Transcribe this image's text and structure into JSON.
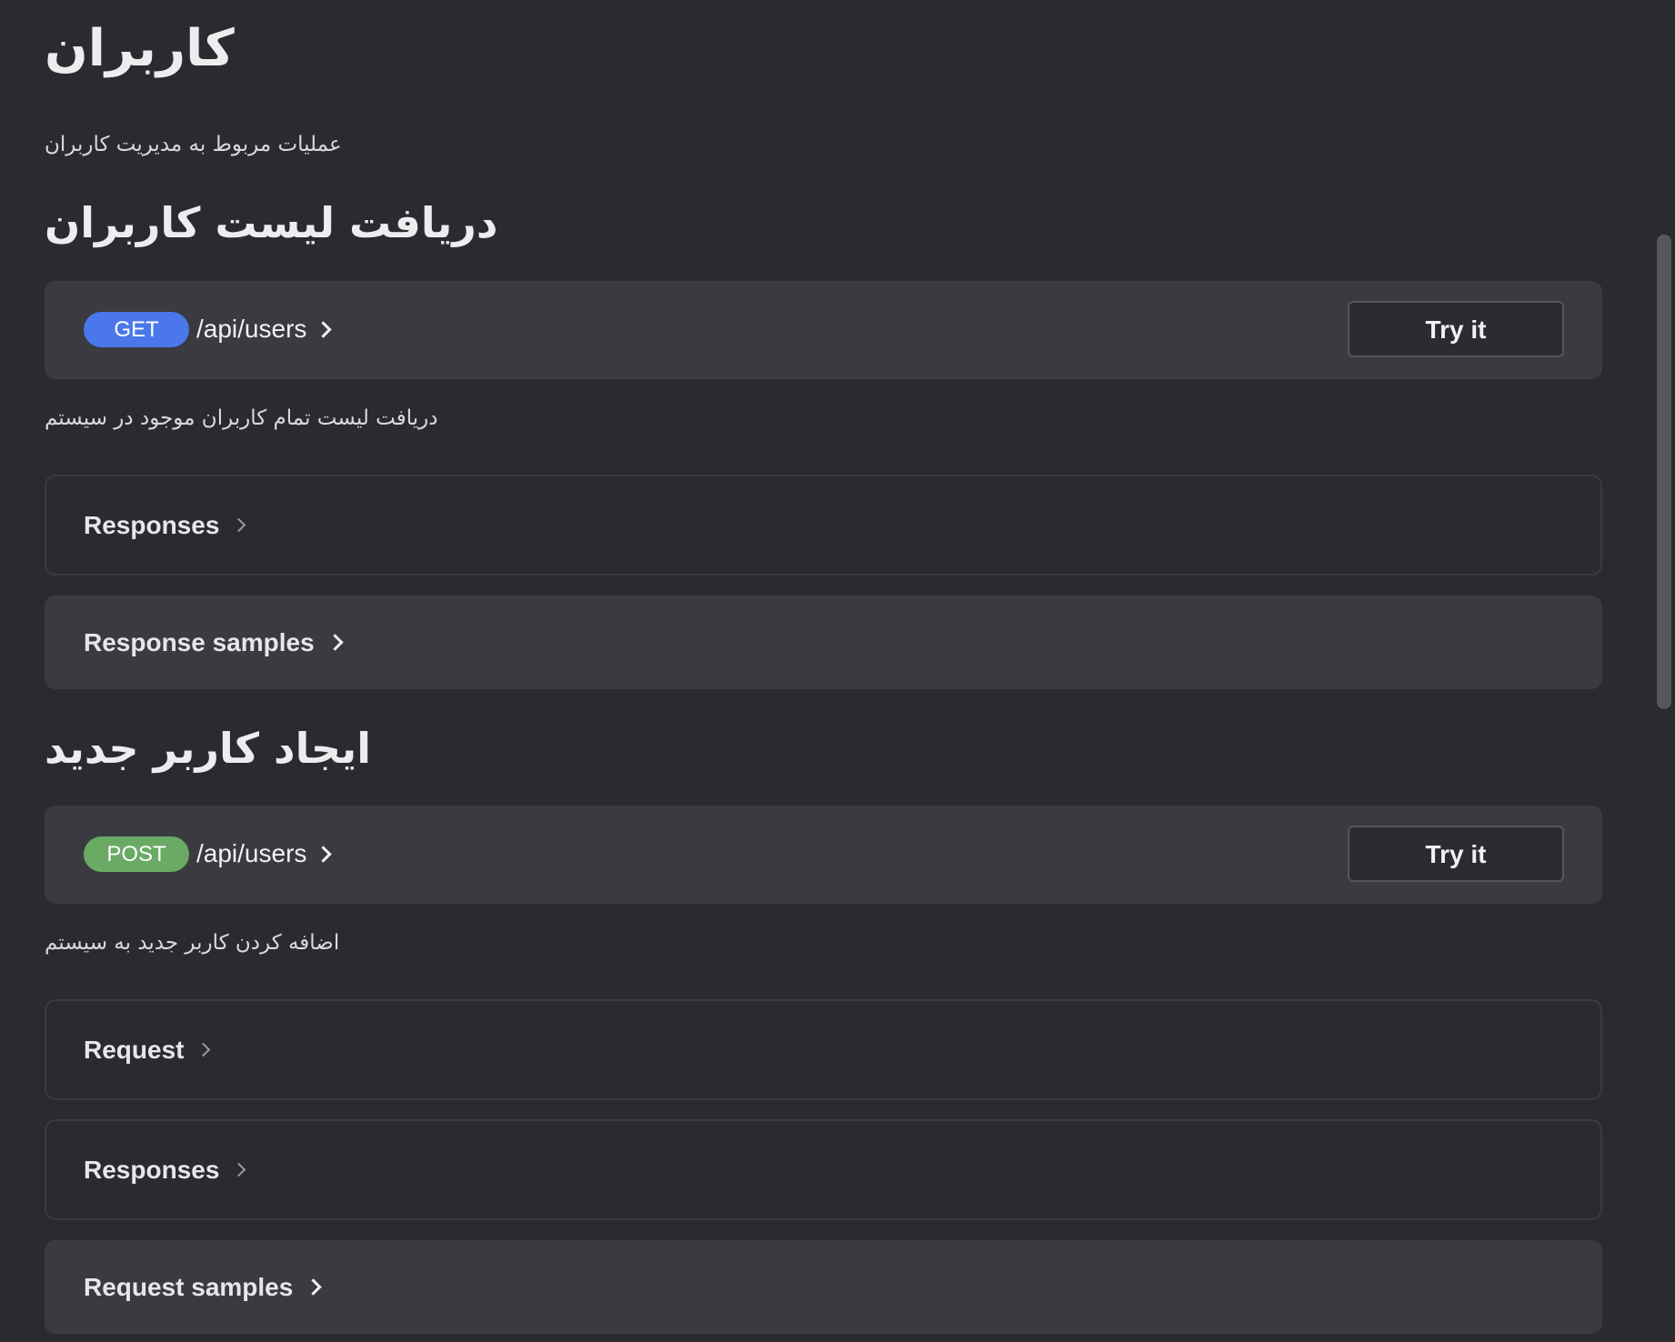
{
  "tag": {
    "title": "کاربران",
    "description": "عملیات مربوط به مدیریت کاربران"
  },
  "operations": [
    {
      "title": "دریافت لیست کاربران",
      "method": "GET",
      "method_color": "#4a78ea",
      "path": "/api/users",
      "try_label": "Try it",
      "description": "دریافت لیست تمام کاربران موجود در سیستم",
      "sections": [
        {
          "label": "Responses",
          "style": "outlined"
        },
        {
          "label": "Response samples",
          "style": "filled"
        }
      ]
    },
    {
      "title": "ایجاد کاربر جدید",
      "method": "POST",
      "method_color": "#6aaa64",
      "path": "/api/users",
      "try_label": "Try it",
      "description": "اضافه کردن کاربر جدید به سیستم",
      "sections": [
        {
          "label": "Request",
          "style": "outlined"
        },
        {
          "label": "Responses",
          "style": "outlined"
        },
        {
          "label": "Request samples",
          "style": "filled"
        }
      ]
    }
  ]
}
